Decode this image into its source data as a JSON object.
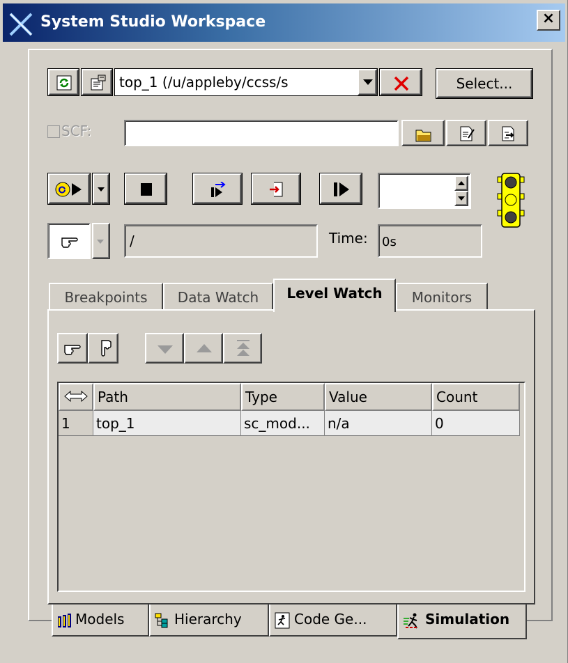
{
  "window": {
    "title": "System Studio Workspace",
    "close_label": "×"
  },
  "toolbar": {
    "design_selector_value": "top_1     (/u/appleby/ccss/s",
    "select_button_label": "Select...",
    "scf_checkbox_label": "SCF:",
    "scf_input_value": ""
  },
  "sim_controls": {
    "step_count_value": "",
    "path_field_value": "/",
    "time_label": "Time:",
    "time_value": "0s"
  },
  "tabs": [
    {
      "label": "Breakpoints",
      "active": false
    },
    {
      "label": "Data Watch",
      "active": false
    },
    {
      "label": "Level Watch",
      "active": true
    },
    {
      "label": "Monitors",
      "active": false
    }
  ],
  "grid": {
    "headers": [
      "Path",
      "Type",
      "Value",
      "Count"
    ],
    "rows": [
      {
        "index": "1",
        "path": "top_1",
        "type": "sc_mod...",
        "value": "n/a",
        "count": "0"
      }
    ]
  },
  "bottom_tabs": [
    {
      "label": "Models",
      "icon": "models-icon",
      "active": false
    },
    {
      "label": "Hierarchy",
      "icon": "hierarchy-icon",
      "active": false
    },
    {
      "label": "Code Ge...",
      "icon": "code-gen-icon",
      "active": false
    },
    {
      "label": "Simulation",
      "icon": "simulation-icon",
      "active": true
    }
  ],
  "colors": {
    "titlebar_start": "#0a246a",
    "titlebar_end": "#a6caf0",
    "face": "#d4d0c8",
    "traffic_light": "#ffff00"
  }
}
